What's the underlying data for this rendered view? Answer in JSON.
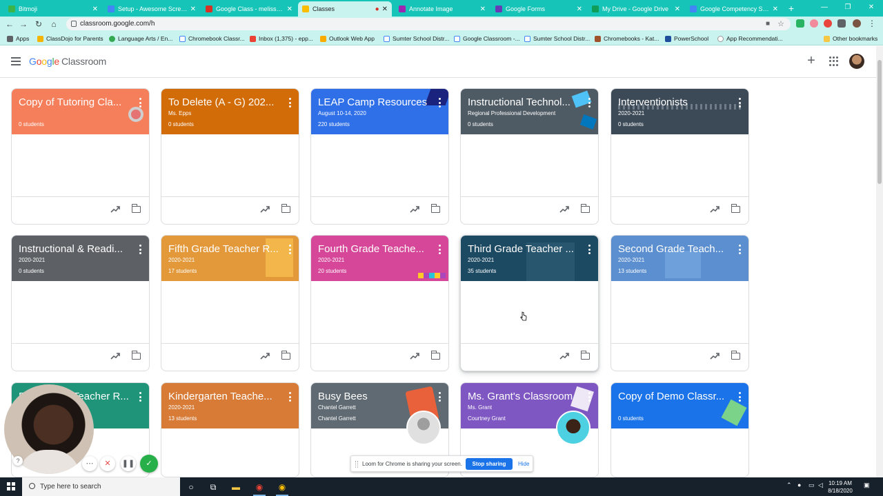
{
  "browser": {
    "tabs": [
      {
        "title": "Bitmoji",
        "color": "#3bb54a"
      },
      {
        "title": "Setup - Awesome Screensh",
        "color": "#4285f4"
      },
      {
        "title": "Google Class - melissa.epp",
        "color": "#d93025"
      },
      {
        "title": "Classes",
        "color": "#fbbc04"
      },
      {
        "title": "Annotate Image",
        "color": "#9c27b0"
      },
      {
        "title": "Google Forms",
        "color": "#673ab7"
      },
      {
        "title": "My Drive - Google Drive",
        "color": "#0f9d58"
      },
      {
        "title": "Google Competency Skills T",
        "color": "#4285f4"
      }
    ],
    "active_tab_index": 3,
    "url": "classroom.google.com/h",
    "bookmarks": [
      "Apps",
      "ClassDojo for Parents",
      "Language Arts / En...",
      "Chromebook Classr...",
      "Inbox (1,375) - epp...",
      "Outlook Web App",
      "Sumter School Distr...",
      "Google Classroom -...",
      "Sumter School Distr...",
      "Chromebooks - Kat...",
      "PowerSchool",
      "App Recommendati...",
      "Other bookmarks"
    ]
  },
  "header": {
    "brand_google": [
      "G",
      "o",
      "o",
      "g",
      "l",
      "e"
    ],
    "brand_product": "Classroom",
    "add_icon": "plus-icon",
    "apps_icon": "apps-grid-icon"
  },
  "cards": [
    {
      "title": "Copy of Tutoring Cla...",
      "section": "",
      "students": "0 students",
      "color": "#f57f5b"
    },
    {
      "title": "To Delete (A - G) 202...",
      "section": "Ms. Epps",
      "students": "0 students",
      "color": "#d16c08"
    },
    {
      "title": "LEAP Camp Resources",
      "section": "August 10-14, 2020",
      "students": "220 students",
      "color": "#2f6fe8"
    },
    {
      "title": "Instructional Technol...",
      "section": "Regional Professional Development",
      "students": "0 students",
      "color": "#4f5b64"
    },
    {
      "title": "Interventionists",
      "section": "2020-2021",
      "students": "0 students",
      "color": "#3c4a57"
    },
    {
      "title": "Instructional & Readi...",
      "section": "2020-2021",
      "students": "0 students",
      "color": "#5d6065"
    },
    {
      "title": "Fifth Grade Teacher R...",
      "section": "2020-2021",
      "students": "17 students",
      "color": "#e3993a"
    },
    {
      "title": "Fourth Grade Teache...",
      "section": "2020-2021",
      "students": "20 students",
      "color": "#d6479a"
    },
    {
      "title": "Third Grade Teacher ...",
      "section": "2020-2021",
      "students": "35 students",
      "color": "#1c4a63"
    },
    {
      "title": "Second Grade Teach...",
      "section": "2020-2021",
      "students": "13 students",
      "color": "#5b8fd0"
    },
    {
      "title": "First Grade Teacher R...",
      "section": "",
      "students": "",
      "color": "#1f9479"
    },
    {
      "title": "Kindergarten Teache...",
      "section": "2020-2021",
      "students": "13 students",
      "color": "#d77b36"
    },
    {
      "title": "Busy Bees",
      "section": "Chantel Garrett",
      "students": "Chantel Garrett",
      "color": "#5f6a72"
    },
    {
      "title": "Ms. Grant's Classroom",
      "section": "Ms. Grant",
      "students": "Courtney Grant",
      "color": "#7e57c2"
    },
    {
      "title": "Copy of Demo Classr...",
      "section": "",
      "students": "0 students",
      "color": "#1a73e8"
    }
  ],
  "loom": {
    "message": "Loom for Chrome is sharing your screen.",
    "stop_label": "Stop sharing",
    "hide_label": "Hide"
  },
  "taskbar": {
    "search_placeholder": "Type here to search",
    "time": "10:19 AM",
    "date": "8/18/2020"
  }
}
